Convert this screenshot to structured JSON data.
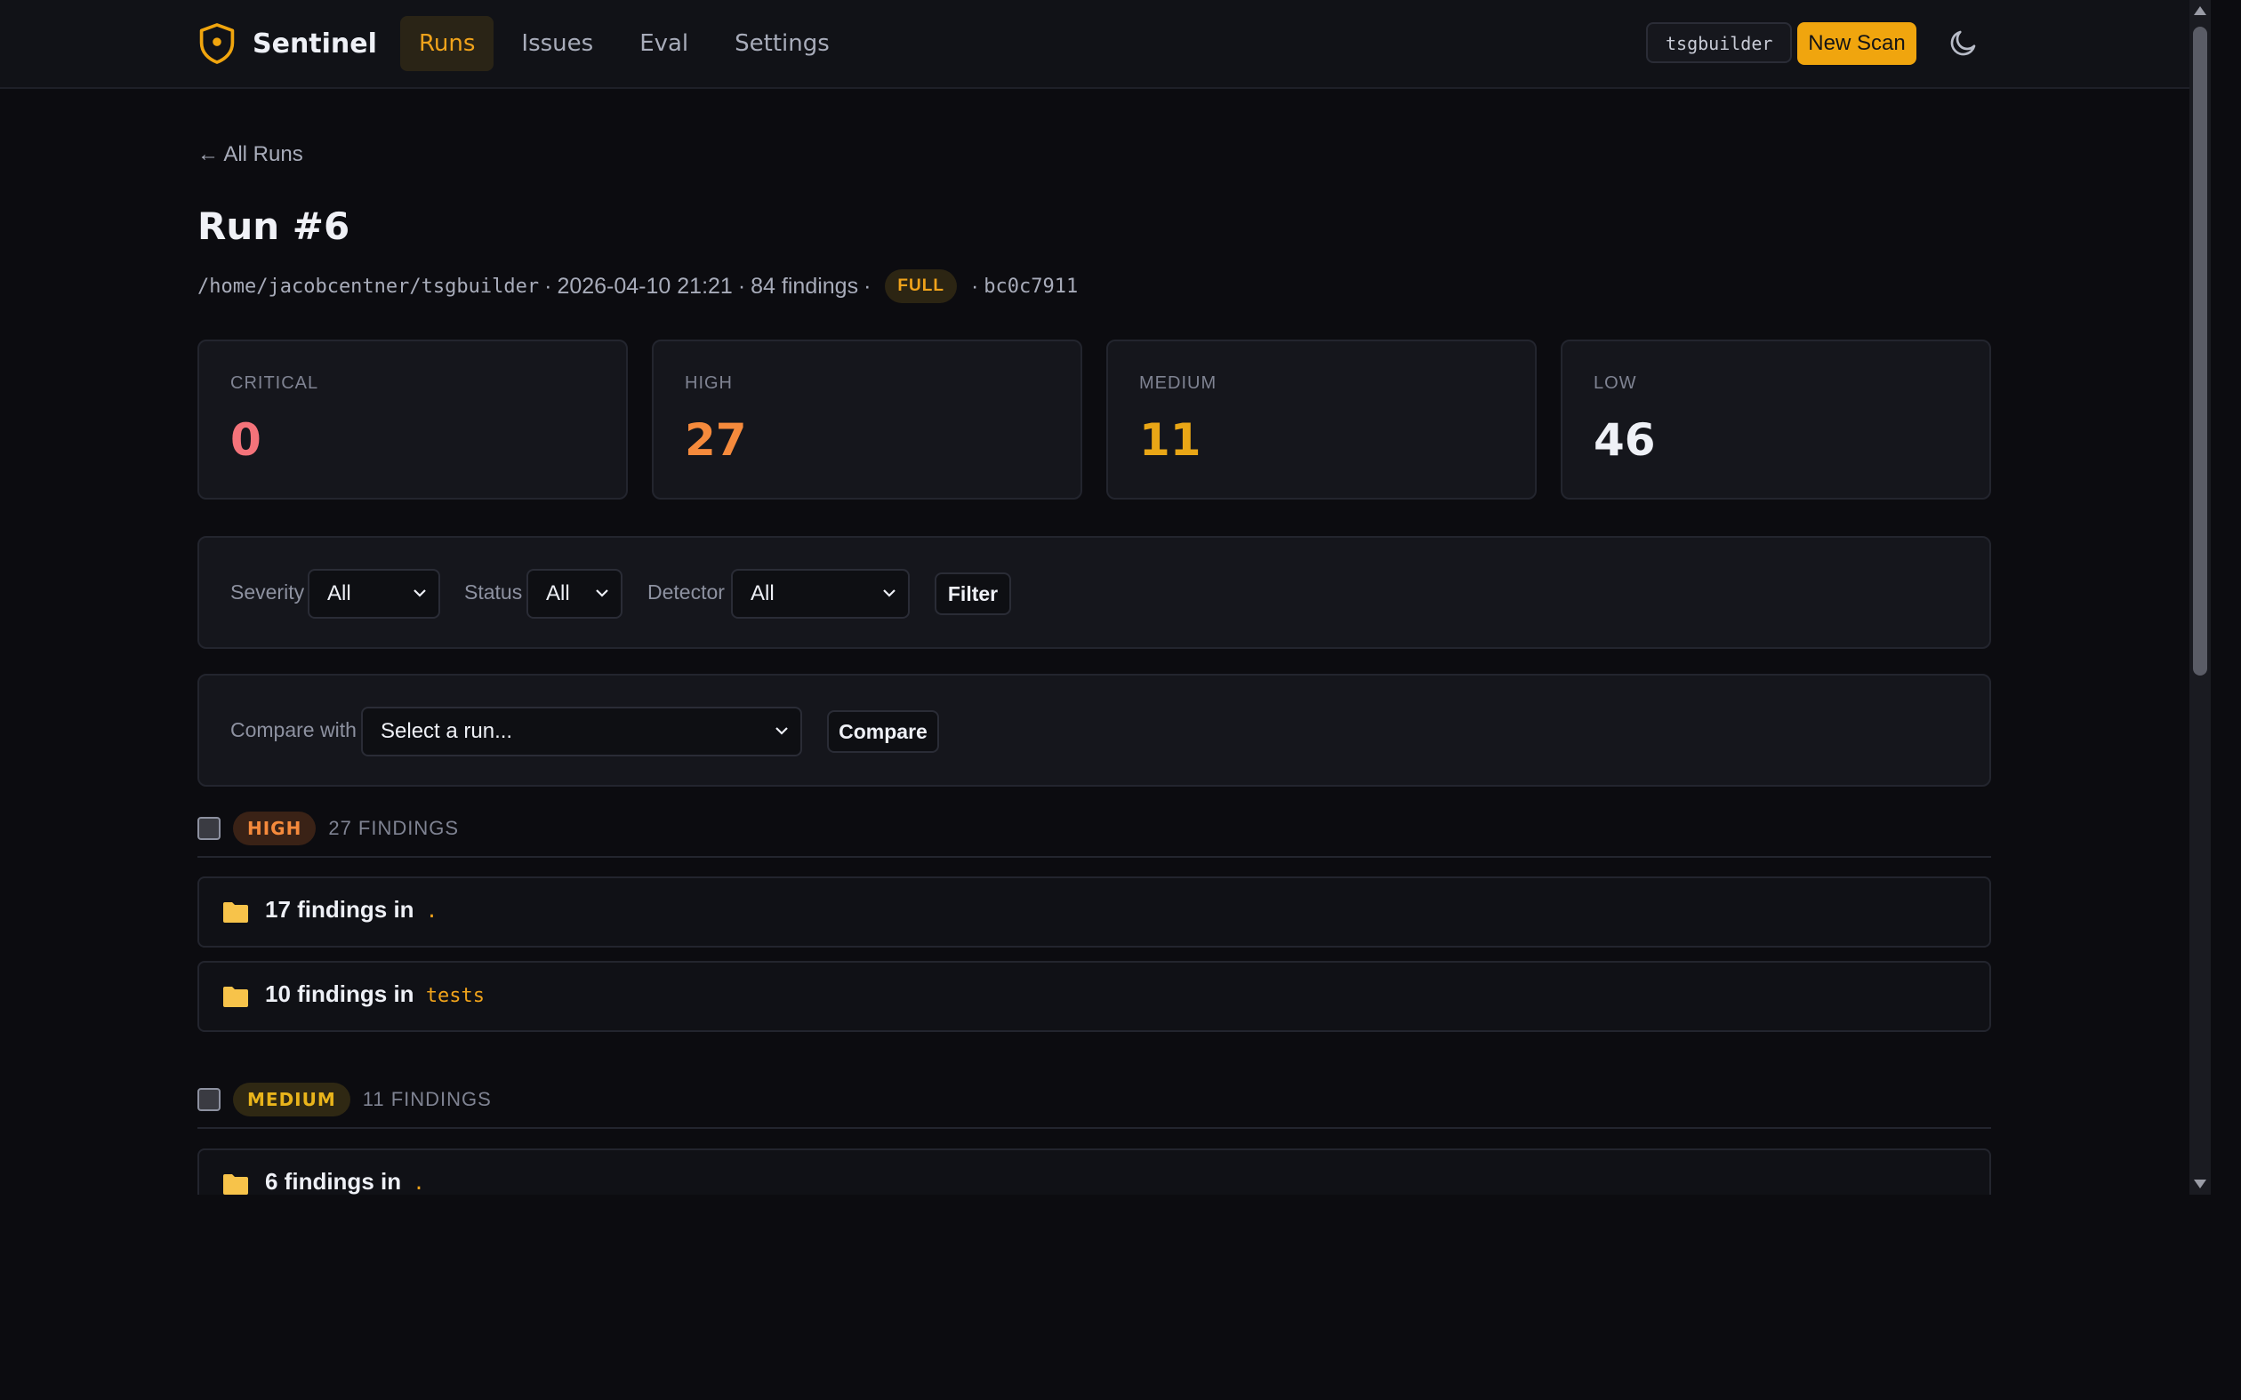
{
  "brand": {
    "name": "Sentinel"
  },
  "nav": [
    {
      "label": "Runs",
      "active": true
    },
    {
      "label": "Issues",
      "active": false
    },
    {
      "label": "Eval",
      "active": false
    },
    {
      "label": "Settings",
      "active": false
    }
  ],
  "header": {
    "user": "tsgbuilder",
    "new_scan_label": "New Scan",
    "theme_icon": "moon-icon"
  },
  "back_link": "← All Runs",
  "run": {
    "title": "Run #6",
    "path": "/home/jacobcentner/tsgbuilder",
    "timestamp": "2026-04-10 21:21",
    "findings": "84 findings",
    "mode": "FULL",
    "commit": "bc0c7911"
  },
  "stats": [
    {
      "label": "CRITICAL",
      "value": "0",
      "color": "#f4737a"
    },
    {
      "label": "HIGH",
      "value": "27",
      "color": "#f58a3c"
    },
    {
      "label": "MEDIUM",
      "value": "11",
      "color": "#e9a616"
    },
    {
      "label": "LOW",
      "value": "46",
      "color": "#eef0f6"
    }
  ],
  "filters": {
    "severity_label": "Severity",
    "severity_value": "All",
    "status_label": "Status",
    "status_value": "All",
    "detector_label": "Detector",
    "detector_value": "All",
    "filter_button": "Filter"
  },
  "compare": {
    "label": "Compare with",
    "placeholder": "Select a run...",
    "button": "Compare"
  },
  "groups": [
    {
      "severity": "HIGH",
      "count_label": "27 FINDINGS",
      "pill_bg": "#3a2216",
      "pill_color": "#f58a3c",
      "folders": [
        {
          "text": "17 findings in",
          "path": "."
        },
        {
          "text": "10 findings in",
          "path": "tests"
        }
      ]
    },
    {
      "severity": "MEDIUM",
      "count_label": "11 FINDINGS",
      "pill_bg": "#2f2813",
      "pill_color": "#e9b41b",
      "folders": [
        {
          "text": "6 findings in",
          "path": "."
        }
      ]
    }
  ]
}
